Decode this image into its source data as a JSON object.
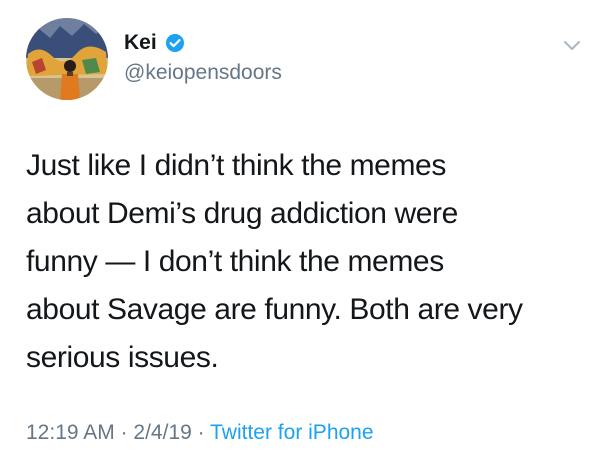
{
  "author": {
    "display_name": "Kei",
    "handle": "@keiopensdoors",
    "verified": true
  },
  "tweet": {
    "lines": [
      "Just like I didn’t think the memes",
      "about Demi’s drug addiction were",
      "funny — I don’t think the memes",
      "about Savage are funny. Both are very",
      "serious issues."
    ],
    "time": "12:19 AM",
    "date": "2/4/19",
    "separator": "·",
    "source": "Twitter for iPhone"
  },
  "colors": {
    "text": "#14171a",
    "secondary": "#657786",
    "accent": "#1da1f2"
  },
  "icons": {
    "verified": "verified-badge-icon",
    "menu": "chevron-down-icon"
  }
}
